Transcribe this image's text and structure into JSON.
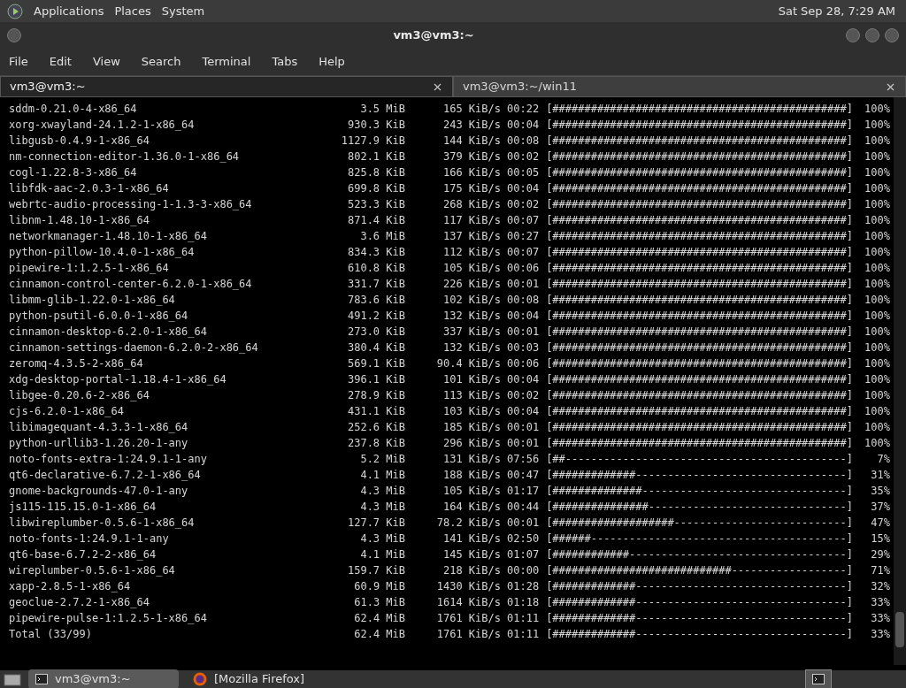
{
  "top_panel": {
    "menus": [
      "Applications",
      "Places",
      "System"
    ],
    "clock": "Sat Sep 28, 7:29 AM"
  },
  "window": {
    "title": "vm3@vm3:~"
  },
  "menu_bar": [
    "File",
    "Edit",
    "View",
    "Search",
    "Terminal",
    "Tabs",
    "Help"
  ],
  "tabs": [
    {
      "label": "vm3@vm3:~",
      "selected": true
    },
    {
      "label": "vm3@vm3:~/win11",
      "selected": false
    }
  ],
  "terminal": {
    "rows": [
      {
        "name": "sddm-0.21.0-4-x86_64",
        "size": "3.5 MiB",
        "speed": "165 KiB/s",
        "eta": "00:22",
        "bar": "[##############################################]",
        "percent": "100%"
      },
      {
        "name": "xorg-xwayland-24.1.2-1-x86_64",
        "size": "930.3 KiB",
        "speed": "243 KiB/s",
        "eta": "00:04",
        "bar": "[##############################################]",
        "percent": "100%"
      },
      {
        "name": "libgusb-0.4.9-1-x86_64",
        "size": "1127.9 KiB",
        "speed": "144 KiB/s",
        "eta": "00:08",
        "bar": "[##############################################]",
        "percent": "100%"
      },
      {
        "name": "nm-connection-editor-1.36.0-1-x86_64",
        "size": "802.1 KiB",
        "speed": "379 KiB/s",
        "eta": "00:02",
        "bar": "[##############################################]",
        "percent": "100%"
      },
      {
        "name": "cogl-1.22.8-3-x86_64",
        "size": "825.8 KiB",
        "speed": "166 KiB/s",
        "eta": "00:05",
        "bar": "[##############################################]",
        "percent": "100%"
      },
      {
        "name": "libfdk-aac-2.0.3-1-x86_64",
        "size": "699.8 KiB",
        "speed": "175 KiB/s",
        "eta": "00:04",
        "bar": "[##############################################]",
        "percent": "100%"
      },
      {
        "name": "webrtc-audio-processing-1-1.3-3-x86_64",
        "size": "523.3 KiB",
        "speed": "268 KiB/s",
        "eta": "00:02",
        "bar": "[##############################################]",
        "percent": "100%"
      },
      {
        "name": "libnm-1.48.10-1-x86_64",
        "size": "871.4 KiB",
        "speed": "117 KiB/s",
        "eta": "00:07",
        "bar": "[##############################################]",
        "percent": "100%"
      },
      {
        "name": "networkmanager-1.48.10-1-x86_64",
        "size": "3.6 MiB",
        "speed": "137 KiB/s",
        "eta": "00:27",
        "bar": "[##############################################]",
        "percent": "100%"
      },
      {
        "name": "python-pillow-10.4.0-1-x86_64",
        "size": "834.3 KiB",
        "speed": "112 KiB/s",
        "eta": "00:07",
        "bar": "[##############################################]",
        "percent": "100%"
      },
      {
        "name": "pipewire-1:1.2.5-1-x86_64",
        "size": "610.8 KiB",
        "speed": "105 KiB/s",
        "eta": "00:06",
        "bar": "[##############################################]",
        "percent": "100%"
      },
      {
        "name": "cinnamon-control-center-6.2.0-1-x86_64",
        "size": "331.7 KiB",
        "speed": "226 KiB/s",
        "eta": "00:01",
        "bar": "[##############################################]",
        "percent": "100%"
      },
      {
        "name": "libmm-glib-1.22.0-1-x86_64",
        "size": "783.6 KiB",
        "speed": "102 KiB/s",
        "eta": "00:08",
        "bar": "[##############################################]",
        "percent": "100%"
      },
      {
        "name": "python-psutil-6.0.0-1-x86_64",
        "size": "491.2 KiB",
        "speed": "132 KiB/s",
        "eta": "00:04",
        "bar": "[##############################################]",
        "percent": "100%"
      },
      {
        "name": "cinnamon-desktop-6.2.0-1-x86_64",
        "size": "273.0 KiB",
        "speed": "337 KiB/s",
        "eta": "00:01",
        "bar": "[##############################################]",
        "percent": "100%"
      },
      {
        "name": "cinnamon-settings-daemon-6.2.0-2-x86_64",
        "size": "380.4 KiB",
        "speed": "132 KiB/s",
        "eta": "00:03",
        "bar": "[##############################################]",
        "percent": "100%"
      },
      {
        "name": "zeromq-4.3.5-2-x86_64",
        "size": "569.1 KiB",
        "speed": "90.4 KiB/s",
        "eta": "00:06",
        "bar": "[##############################################]",
        "percent": "100%"
      },
      {
        "name": "xdg-desktop-portal-1.18.4-1-x86_64",
        "size": "396.1 KiB",
        "speed": "101 KiB/s",
        "eta": "00:04",
        "bar": "[##############################################]",
        "percent": "100%"
      },
      {
        "name": "libgee-0.20.6-2-x86_64",
        "size": "278.9 KiB",
        "speed": "113 KiB/s",
        "eta": "00:02",
        "bar": "[##############################################]",
        "percent": "100%"
      },
      {
        "name": "cjs-6.2.0-1-x86_64",
        "size": "431.1 KiB",
        "speed": "103 KiB/s",
        "eta": "00:04",
        "bar": "[##############################################]",
        "percent": "100%"
      },
      {
        "name": "libimagequant-4.3.3-1-x86_64",
        "size": "252.6 KiB",
        "speed": "185 KiB/s",
        "eta": "00:01",
        "bar": "[##############################################]",
        "percent": "100%"
      },
      {
        "name": "python-urllib3-1.26.20-1-any",
        "size": "237.8 KiB",
        "speed": "296 KiB/s",
        "eta": "00:01",
        "bar": "[##############################################]",
        "percent": "100%"
      },
      {
        "name": "noto-fonts-extra-1:24.9.1-1-any",
        "size": "5.2 MiB",
        "speed": "131 KiB/s",
        "eta": "07:56",
        "bar": "[##--------------------------------------------]",
        "percent": "7%"
      },
      {
        "name": "qt6-declarative-6.7.2-1-x86_64",
        "size": "4.1 MiB",
        "speed": "188 KiB/s",
        "eta": "00:47",
        "bar": "[#############---------------------------------]",
        "percent": "31%"
      },
      {
        "name": "gnome-backgrounds-47.0-1-any",
        "size": "4.3 MiB",
        "speed": "105 KiB/s",
        "eta": "01:17",
        "bar": "[##############--------------------------------]",
        "percent": "35%"
      },
      {
        "name": "js115-115.15.0-1-x86_64",
        "size": "4.3 MiB",
        "speed": "164 KiB/s",
        "eta": "00:44",
        "bar": "[###############-------------------------------]",
        "percent": "37%"
      },
      {
        "name": "libwireplumber-0.5.6-1-x86_64",
        "size": "127.7 KiB",
        "speed": "78.2 KiB/s",
        "eta": "00:01",
        "bar": "[###################---------------------------]",
        "percent": "47%"
      },
      {
        "name": "noto-fonts-1:24.9.1-1-any",
        "size": "4.3 MiB",
        "speed": "141 KiB/s",
        "eta": "02:50",
        "bar": "[######----------------------------------------]",
        "percent": "15%"
      },
      {
        "name": "qt6-base-6.7.2-2-x86_64",
        "size": "4.1 MiB",
        "speed": "145 KiB/s",
        "eta": "01:07",
        "bar": "[############----------------------------------]",
        "percent": "29%"
      },
      {
        "name": "wireplumber-0.5.6-1-x86_64",
        "size": "159.7 KiB",
        "speed": "218 KiB/s",
        "eta": "00:00",
        "bar": "[############################------------------]",
        "percent": "71%"
      },
      {
        "name": "xapp-2.8.5-1-x86_64",
        "size": "60.9 MiB",
        "speed": "1430 KiB/s",
        "eta": "01:28",
        "bar": "[#############---------------------------------]",
        "percent": "32%"
      },
      {
        "name": "geoclue-2.7.2-1-x86_64",
        "size": "61.3 MiB",
        "speed": "1614 KiB/s",
        "eta": "01:18",
        "bar": "[#############---------------------------------]",
        "percent": "33%"
      },
      {
        "name": "pipewire-pulse-1:1.2.5-1-x86_64",
        "size": "62.4 MiB",
        "speed": "1761 KiB/s",
        "eta": "01:11",
        "bar": "[#############---------------------------------]",
        "percent": "33%"
      },
      {
        "name": "Total (33/99)",
        "size": "62.4 MiB",
        "speed": "1761 KiB/s",
        "eta": "01:11",
        "bar": "[#############---------------------------------]",
        "percent": "33%"
      }
    ]
  },
  "taskbar": {
    "items": [
      {
        "kind": "terminal",
        "label": "vm3@vm3:~",
        "selected": true
      },
      {
        "kind": "browser",
        "label": "[Mozilla Firefox]",
        "selected": false
      }
    ]
  }
}
